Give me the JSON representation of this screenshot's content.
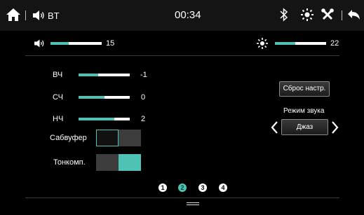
{
  "statusbar": {
    "source": "BT",
    "clock": "00:34"
  },
  "quick": {
    "volume": {
      "value": "15",
      "level": 0.35
    },
    "brightness": {
      "value": "22",
      "level": 0.4
    }
  },
  "eq": {
    "bands": [
      {
        "label": "ВЧ",
        "value": "-1",
        "level": 0.38
      },
      {
        "label": "СЧ",
        "value": "0",
        "level": 0.5
      },
      {
        "label": "НЧ",
        "value": "2",
        "level": 0.7
      }
    ],
    "subwoofer": {
      "label": "Сабвуфер",
      "state": "off"
    },
    "loudness": {
      "label": "Тонкомп.",
      "state": "on"
    }
  },
  "sound": {
    "reset_label": "Сброс настр.",
    "mode_title": "Режим звука",
    "mode_value": "Джаз"
  },
  "pages": {
    "items": [
      "1",
      "2",
      "3",
      "4"
    ],
    "active": 1
  },
  "colors": {
    "accent": "#4fc2b6",
    "background": "#000000",
    "topbar": "#141414"
  },
  "icons": [
    "home-icon",
    "speaker-icon",
    "bluetooth-icon",
    "brightness-icon",
    "settings-icon",
    "back-icon",
    "chevron-left-icon",
    "chevron-right-icon",
    "menu-handle-icon"
  ]
}
